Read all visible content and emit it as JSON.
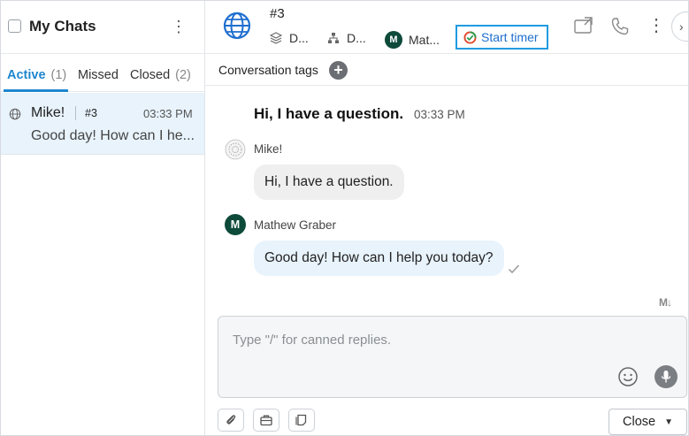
{
  "left": {
    "title": "My Chats",
    "tabs": [
      {
        "label": "Active",
        "count": "(1)"
      },
      {
        "label": "Missed",
        "count": ""
      },
      {
        "label": "Closed",
        "count": "(2)"
      }
    ],
    "chat": {
      "name": "Mike!",
      "number": "#3",
      "time": "03:33 PM",
      "preview": "Good day! How can I he..."
    }
  },
  "header": {
    "conversation_number": "#3",
    "department": "D...",
    "group": "D...",
    "agent_initial": "M",
    "agent_name": "Mat...",
    "start_timer": "Start timer"
  },
  "tags": {
    "label": "Conversation tags",
    "add": "+"
  },
  "messages": {
    "title": "Hi, I have a question.",
    "title_time": "03:33 PM",
    "visitor_name": "Mike!",
    "visitor_text": "Hi, I have a question.",
    "agent_initial": "M",
    "agent_name": "Mathew Graber",
    "agent_text": "Good day! How can I help you today?"
  },
  "composer": {
    "placeholder": "Type \"/\" for canned replies.",
    "markdown_label": "M↓"
  },
  "footer": {
    "close_label": "Close"
  },
  "colors": {
    "accent": "#1f86cf",
    "selected_row": "#e8f3fc",
    "agent_avatar": "#0e4a3a",
    "timer_border": "#1f9be0"
  }
}
